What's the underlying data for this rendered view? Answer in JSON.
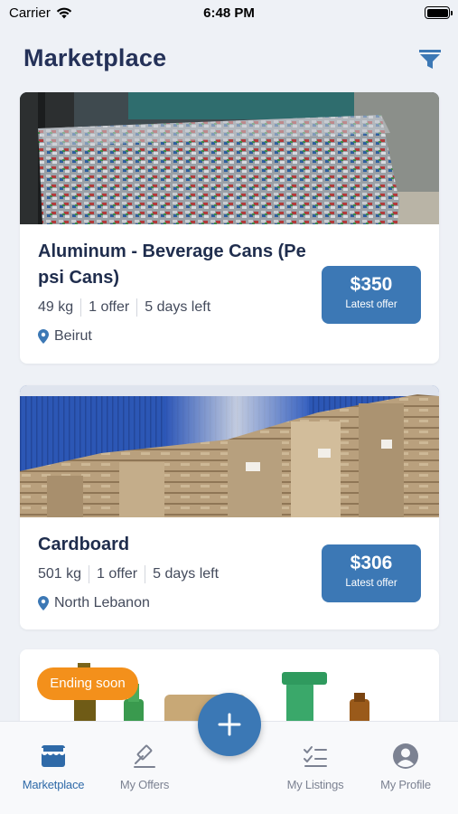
{
  "status_bar": {
    "carrier": "Carrier",
    "time": "6:48 PM"
  },
  "header": {
    "title": "Marketplace",
    "filter_icon": "filter-funnel-icon"
  },
  "listings": [
    {
      "name": "Aluminum - Beverage Cans (Pepsi Cans)",
      "weight": "49 kg",
      "offers": "1 offer",
      "time_left": "5 days left",
      "location": "Beirut",
      "price": "$350",
      "price_sub": "Latest offer",
      "image": "crushed aluminum cans bale"
    },
    {
      "name": "Cardboard",
      "weight": "501 kg",
      "offers": "1 offer",
      "time_left": "5 days left",
      "location": "North Lebanon",
      "price": "$306",
      "price_sub": "Latest offer",
      "image": "cardboard bales"
    },
    {
      "badge": "Ending soon",
      "image": "glass and plastic bottles"
    }
  ],
  "tabbar": {
    "tabs": [
      {
        "label": "Marketplace",
        "icon": "storefront-icon",
        "active": true
      },
      {
        "label": "My Offers",
        "icon": "gavel-icon",
        "active": false
      },
      {
        "label": "My Listings",
        "icon": "checklist-icon",
        "active": false
      },
      {
        "label": "My Profile",
        "icon": "profile-icon",
        "active": false
      }
    ],
    "fab_icon": "plus-icon"
  },
  "colors": {
    "accent": "#3c78b5",
    "title": "#243158",
    "badge": "#f3901b",
    "background": "#eef1f6"
  }
}
